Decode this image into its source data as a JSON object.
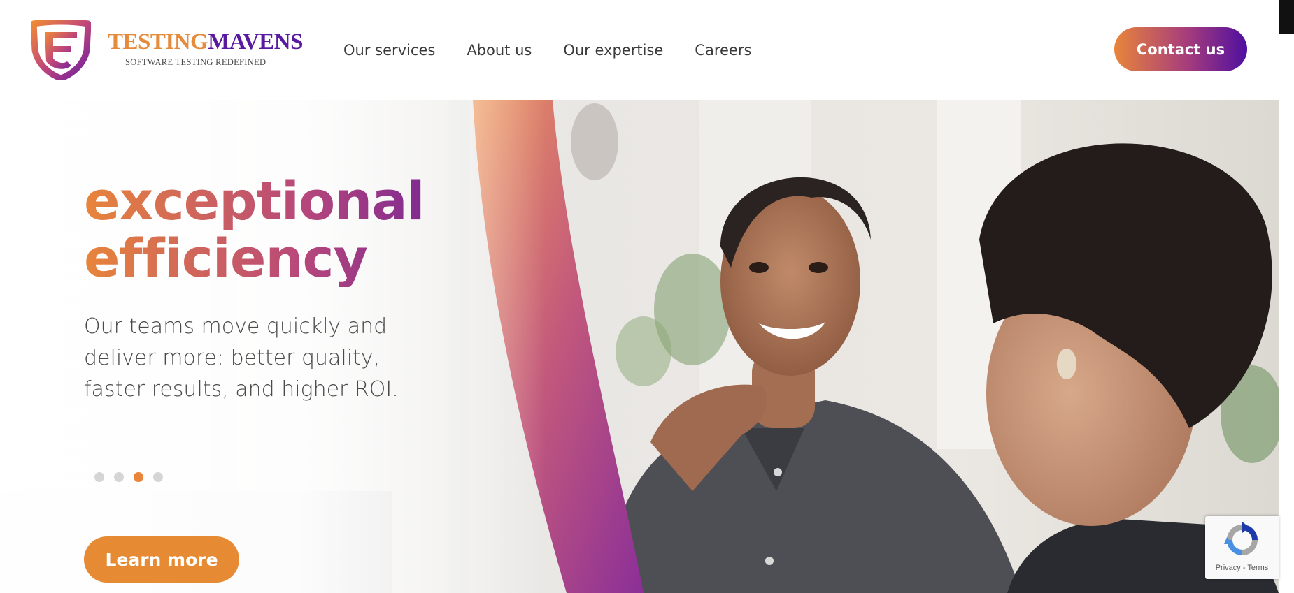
{
  "brand": {
    "name_part1": "TESTING",
    "name_part2": "MAVENS",
    "tagline": "SOFTWARE TESTING REDEFINED",
    "colors": {
      "orange": "#e8853a",
      "purple": "#5a1aa0"
    }
  },
  "nav": {
    "items": [
      {
        "label": "Our services"
      },
      {
        "label": "About us"
      },
      {
        "label": "Our expertise"
      },
      {
        "label": "Careers"
      }
    ]
  },
  "header": {
    "contact_label": "Contact us"
  },
  "hero": {
    "headline_line1": "exceptional",
    "headline_line2": "efficiency",
    "subtext": "Our teams move quickly and deliver more: better quality, faster results, and higher ROI.",
    "cta_label": "Learn more",
    "slides": {
      "count": 4,
      "active_index": 3
    }
  },
  "recaptcha": {
    "privacy_label": "Privacy",
    "separator": "-",
    "terms_label": "Terms"
  },
  "icons": [
    "shield-logo-icon",
    "recaptcha-icon"
  ]
}
